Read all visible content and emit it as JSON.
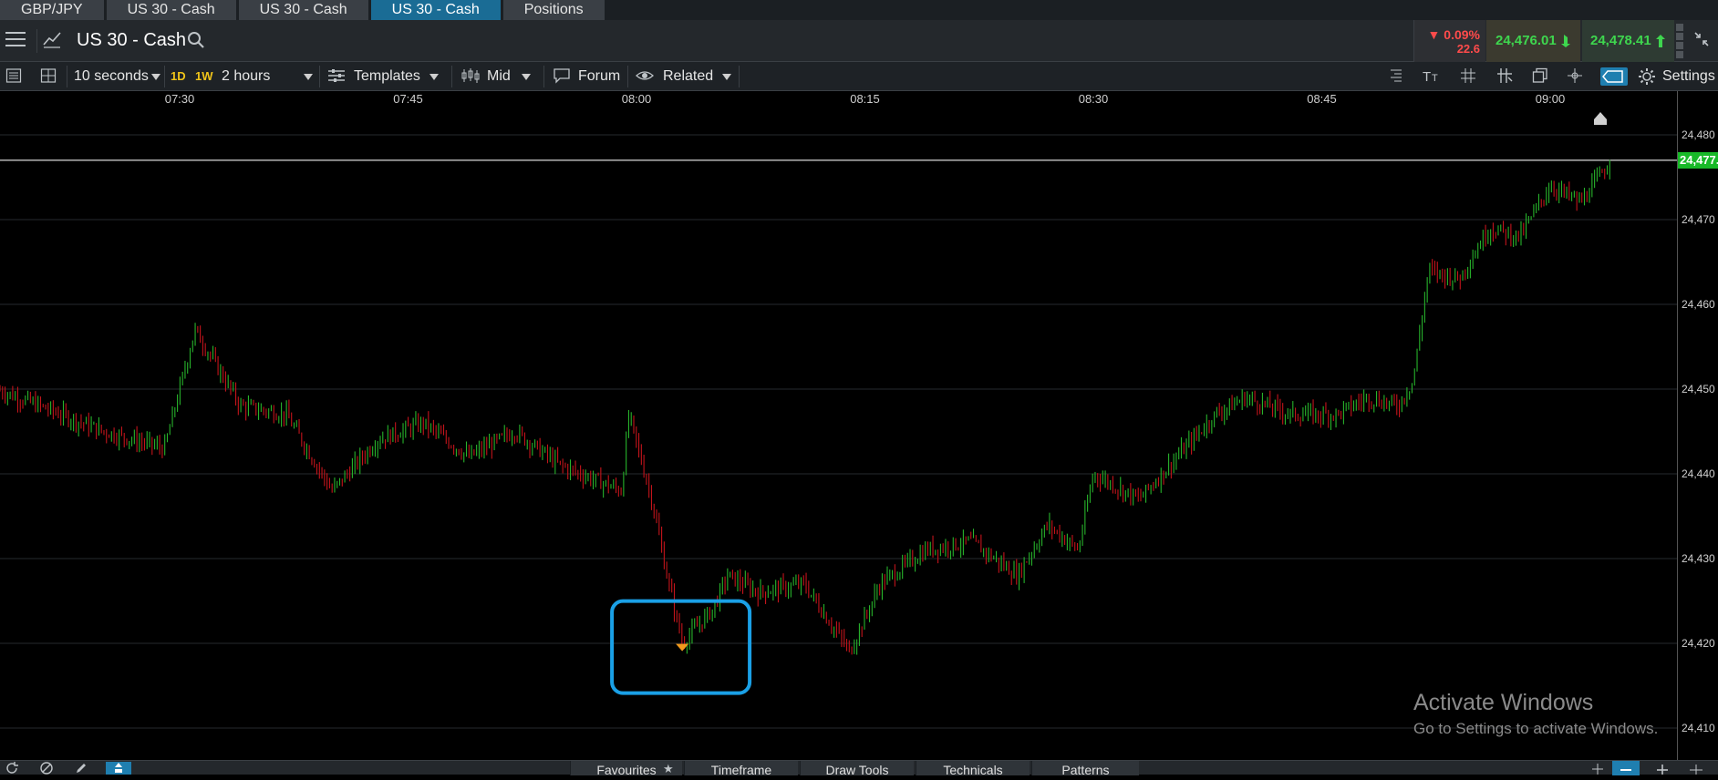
{
  "tabs": [
    {
      "label": "GBP/JPY",
      "active": false
    },
    {
      "label": "US 30 - Cash",
      "active": false
    },
    {
      "label": "US 30 - Cash",
      "active": false
    },
    {
      "label": "US 30 - Cash",
      "active": true
    },
    {
      "label": "Positions",
      "active": false
    }
  ],
  "header": {
    "instrument": "US 30 - Cash",
    "change_pct": "0.09%",
    "change_points": "22.6",
    "sell_price": "24,476.01",
    "buy_price": "24,478.41"
  },
  "toolbar": {
    "interval": "10 seconds",
    "period_1d": "1D",
    "period_1w": "1W",
    "range": "2 hours",
    "templates": "Templates",
    "price_type": "Mid",
    "forum": "Forum",
    "related": "Related",
    "settings": "Settings"
  },
  "watermark": {
    "title": "Activate Windows",
    "subtitle": "Go to Settings to activate Windows."
  },
  "bottom_bar": {
    "tabs": [
      "Favourites",
      "Timeframe",
      "Draw Tools",
      "Technicals",
      "Patterns"
    ]
  },
  "colors": {
    "up": "#27b32b",
    "down": "#c3141b",
    "accent": "#1f7fb0",
    "highlight_box": "#1aa0e6",
    "marker": "#f29a1c"
  },
  "chart_data": {
    "type": "candlestick",
    "instrument": "US 30 - Cash",
    "x_ticks": [
      "07:30",
      "07:45",
      "08:00",
      "08:15",
      "08:30",
      "08:45",
      "09:00"
    ],
    "y_ticks": [
      "24,410",
      "24,420",
      "24,430",
      "24,440",
      "24,450",
      "24,460",
      "24,470",
      "24,480"
    ],
    "ylim": [
      24408,
      24488
    ],
    "current_price": 24477,
    "current_price_label": "24,477.",
    "price_path": [
      {
        "time": "07:18",
        "price": 24450
      },
      {
        "time": "07:25",
        "price": 24445
      },
      {
        "time": "07:29",
        "price": 24443
      },
      {
        "time": "07:31",
        "price": 24457
      },
      {
        "time": "07:34",
        "price": 24448
      },
      {
        "time": "07:37",
        "price": 24447
      },
      {
        "time": "07:40",
        "price": 24438
      },
      {
        "time": "07:43",
        "price": 24444
      },
      {
        "time": "07:46",
        "price": 24446
      },
      {
        "time": "07:49",
        "price": 24442
      },
      {
        "time": "07:52",
        "price": 24445
      },
      {
        "time": "07:55",
        "price": 24441
      },
      {
        "time": "07:59",
        "price": 24438
      },
      {
        "time": "07:59.5",
        "price": 24447
      },
      {
        "time": "08:01",
        "price": 24437
      },
      {
        "time": "08:02",
        "price": 24428
      },
      {
        "time": "08:03",
        "price": 24420
      },
      {
        "time": "08:05",
        "price": 24424
      },
      {
        "time": "08:06",
        "price": 24428
      },
      {
        "time": "08:08",
        "price": 24426
      },
      {
        "time": "08:11",
        "price": 24427
      },
      {
        "time": "08:14",
        "price": 24419
      },
      {
        "time": "08:16",
        "price": 24427
      },
      {
        "time": "08:19",
        "price": 24431
      },
      {
        "time": "08:22",
        "price": 24432
      },
      {
        "time": "08:25",
        "price": 24428
      },
      {
        "time": "08:27",
        "price": 24434
      },
      {
        "time": "08:29",
        "price": 24431
      },
      {
        "time": "08:30",
        "price": 24440
      },
      {
        "time": "08:33",
        "price": 24437
      },
      {
        "time": "08:35",
        "price": 24441
      },
      {
        "time": "08:38",
        "price": 24447
      },
      {
        "time": "08:40",
        "price": 24449
      },
      {
        "time": "08:43",
        "price": 24447
      },
      {
        "time": "08:46",
        "price": 24447
      },
      {
        "time": "08:48",
        "price": 24449
      },
      {
        "time": "08:50",
        "price": 24448
      },
      {
        "time": "08:51",
        "price": 24451
      },
      {
        "time": "08:52",
        "price": 24464
      },
      {
        "time": "08:54",
        "price": 24463
      },
      {
        "time": "08:56",
        "price": 24469
      },
      {
        "time": "08:58",
        "price": 24468
      },
      {
        "time": "09:00",
        "price": 24474
      },
      {
        "time": "09:02",
        "price": 24472
      },
      {
        "time": "09:04",
        "price": 24477
      }
    ],
    "annotation": {
      "type": "low-marker",
      "time": "08:03",
      "price": 24419.5
    }
  }
}
